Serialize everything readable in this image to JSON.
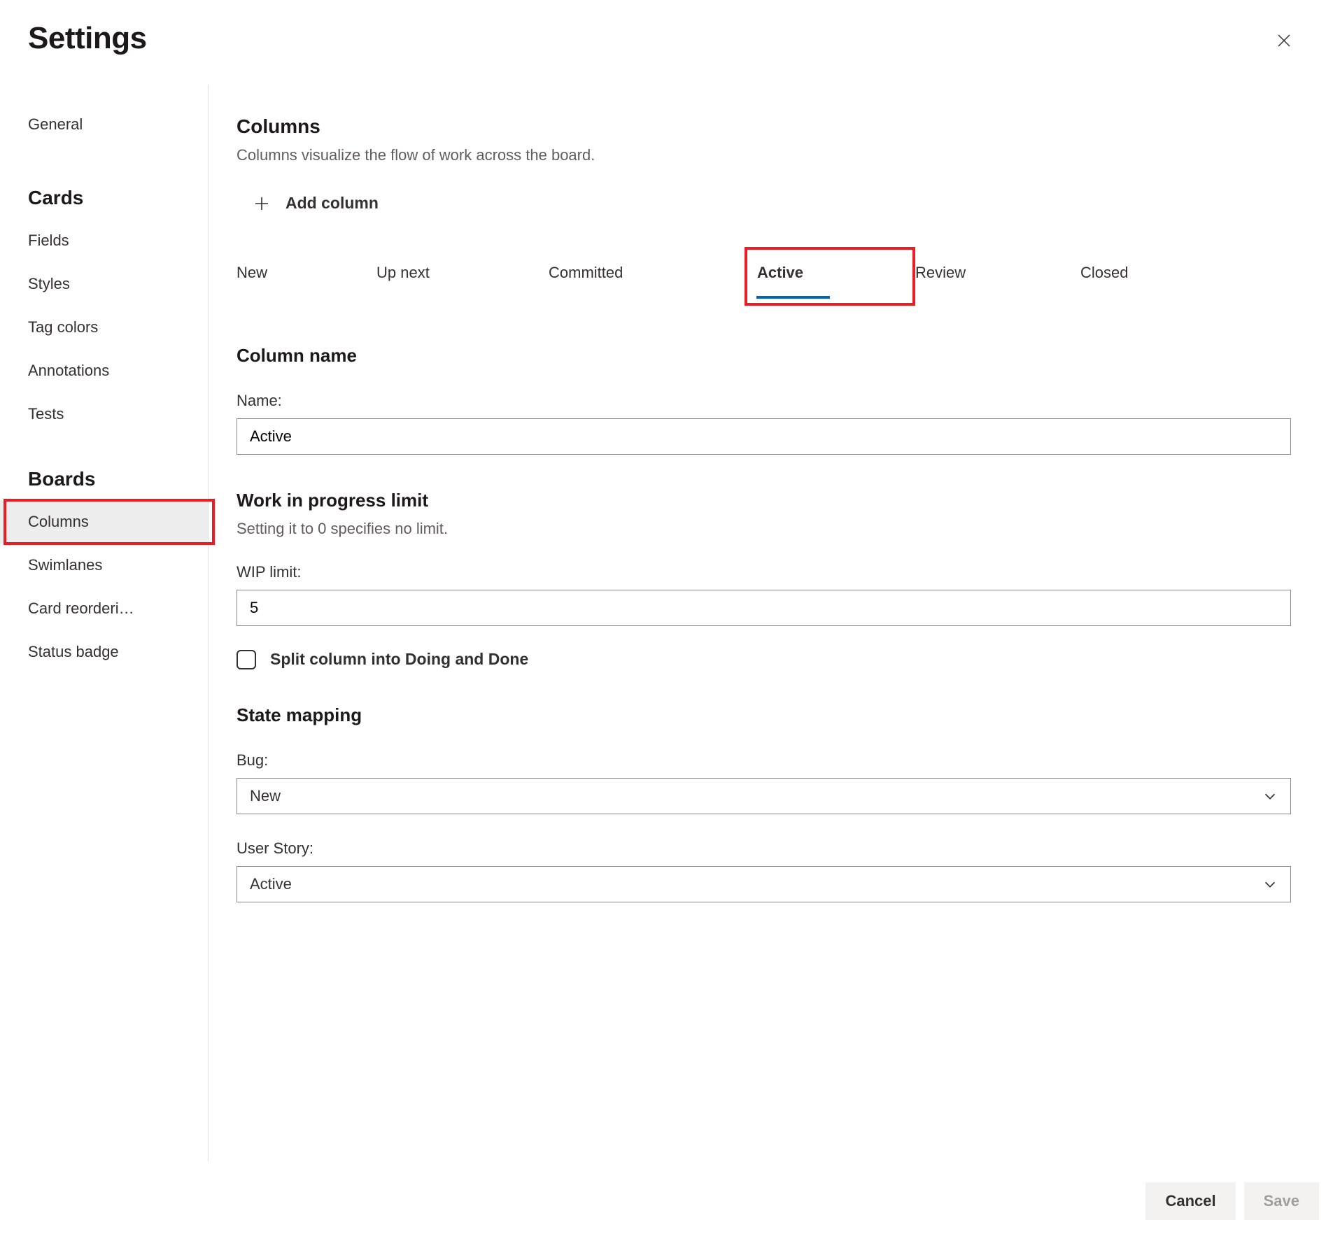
{
  "dialog": {
    "title": "Settings"
  },
  "sidebar": {
    "general": "General",
    "group_cards": "Cards",
    "fields": "Fields",
    "styles": "Styles",
    "tag_colors": "Tag colors",
    "annotations": "Annotations",
    "tests": "Tests",
    "group_boards": "Boards",
    "columns": "Columns",
    "swimlanes": "Swimlanes",
    "card_reordering": "Card reorderi…",
    "status_badge": "Status badge"
  },
  "main": {
    "heading": "Columns",
    "subtitle": "Columns visualize the flow of work across the board.",
    "add_column": "Add column",
    "tabs": {
      "new": "New",
      "up_next": "Up next",
      "committed": "Committed",
      "active": "Active",
      "review": "Review",
      "closed": "Closed"
    },
    "column_name": {
      "heading": "Column name",
      "label": "Name:",
      "value": "Active"
    },
    "wip": {
      "heading": "Work in progress limit",
      "sub": "Setting it to 0 specifies no limit.",
      "label": "WIP limit:",
      "value": "5"
    },
    "split_label": "Split column into Doing and Done",
    "state_mapping": {
      "heading": "State mapping",
      "bug_label": "Bug:",
      "bug_value": "New",
      "user_story_label": "User Story:",
      "user_story_value": "Active"
    }
  },
  "footer": {
    "cancel": "Cancel",
    "save": "Save"
  }
}
